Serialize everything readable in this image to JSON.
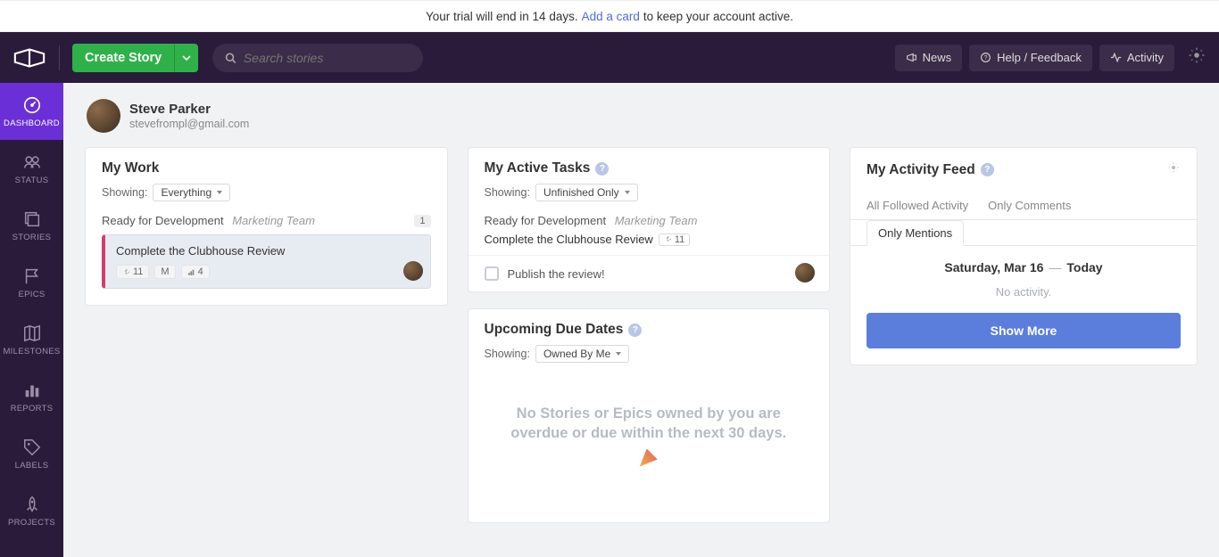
{
  "trial": {
    "prefix": "Your trial will end in 14 days.",
    "link": "Add a card",
    "suffix": "to keep your account active."
  },
  "header": {
    "create_label": "Create Story",
    "search_placeholder": "Search stories",
    "news": "News",
    "help": "Help / Feedback",
    "activity": "Activity"
  },
  "sidebar": [
    "DASHBOARD",
    "STATUS",
    "STORIES",
    "EPICS",
    "MILESTONES",
    "REPORTS",
    "LABELS",
    "PROJECTS"
  ],
  "user": {
    "name": "Steve Parker",
    "email": "stevefrompl@gmail.com"
  },
  "mywork": {
    "title": "My Work",
    "showing_label": "Showing:",
    "showing_value": "Everything",
    "state": "Ready for Development",
    "team": "Marketing Team",
    "count": "1",
    "story_title": "Complete the Clubhouse Review",
    "tag_wrench": "11",
    "tag_m": "M",
    "tag_chart": "4"
  },
  "tasks": {
    "title": "My Active Tasks",
    "showing_label": "Showing:",
    "showing_value": "Unfinished Only",
    "state": "Ready for Development",
    "team": "Marketing Team",
    "story_title": "Complete the Clubhouse Review",
    "pill": "11",
    "subtask": "Publish the review!"
  },
  "upcoming": {
    "title": "Upcoming Due Dates",
    "showing_label": "Showing:",
    "showing_value": "Owned By Me",
    "empty": "No Stories or Epics owned by you are overdue or due within the next 30 days."
  },
  "feed": {
    "title": "My Activity Feed",
    "tab_all": "All Followed Activity",
    "tab_comments": "Only Comments",
    "tab_mentions": "Only Mentions",
    "date_a": "Saturday, Mar 16",
    "date_b": "Today",
    "no_activity": "No activity.",
    "show_more": "Show More"
  }
}
